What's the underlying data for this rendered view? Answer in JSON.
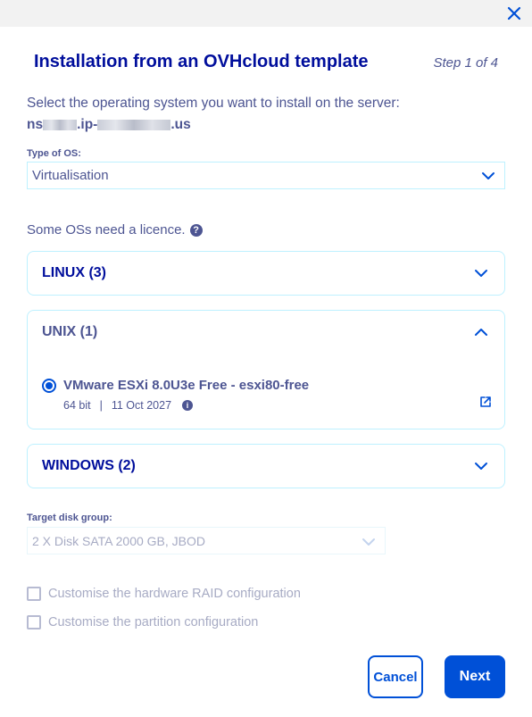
{
  "modal": {
    "title": "Installation from an OVHcloud template",
    "step": "Step 1 of 4",
    "close_icon": "close-icon"
  },
  "prompt": "Select the operating system you want to install on the server:",
  "server": {
    "prefix": "ns",
    "middle": ".ip-",
    "suffix": ".us"
  },
  "os_type": {
    "label": "Type of OS:",
    "value": "Virtualisation"
  },
  "licence_note": "Some OSs need a licence.",
  "groups": [
    {
      "label": "LINUX (3)",
      "expanded": false
    },
    {
      "label": "UNIX (1)",
      "expanded": true,
      "items": [
        {
          "name": "VMware ESXi 8.0U3e Free - esxi80-free",
          "arch": "64 bit",
          "separator": "|",
          "date": "11 Oct 2027",
          "selected": true
        }
      ]
    },
    {
      "label": "WINDOWS (2)",
      "expanded": false
    }
  ],
  "disk": {
    "label": "Target disk group:",
    "value": "2 X Disk SATA 2000 GB, JBOD"
  },
  "options": {
    "raid": "Customise the hardware RAID configuration",
    "partition": "Customise the partition configuration"
  },
  "buttons": {
    "cancel": "Cancel",
    "next": "Next"
  },
  "colors": {
    "primary": "#0050d7",
    "heading": "#000e9c",
    "text": "#4d5592",
    "border": "#bef1ff",
    "disabled": "#a7abc4"
  }
}
